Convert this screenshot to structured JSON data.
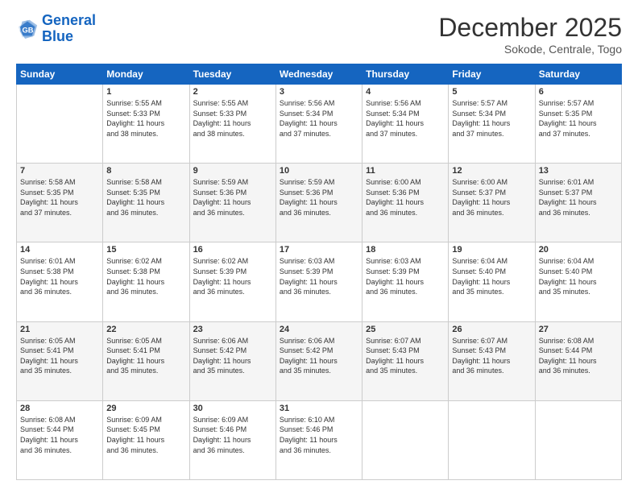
{
  "header": {
    "logo_line1": "General",
    "logo_line2": "Blue",
    "month": "December 2025",
    "location": "Sokode, Centrale, Togo"
  },
  "days_of_week": [
    "Sunday",
    "Monday",
    "Tuesday",
    "Wednesday",
    "Thursday",
    "Friday",
    "Saturday"
  ],
  "weeks": [
    [
      {
        "day": "",
        "info": ""
      },
      {
        "day": "1",
        "info": "Sunrise: 5:55 AM\nSunset: 5:33 PM\nDaylight: 11 hours\nand 38 minutes."
      },
      {
        "day": "2",
        "info": "Sunrise: 5:55 AM\nSunset: 5:33 PM\nDaylight: 11 hours\nand 38 minutes."
      },
      {
        "day": "3",
        "info": "Sunrise: 5:56 AM\nSunset: 5:34 PM\nDaylight: 11 hours\nand 37 minutes."
      },
      {
        "day": "4",
        "info": "Sunrise: 5:56 AM\nSunset: 5:34 PM\nDaylight: 11 hours\nand 37 minutes."
      },
      {
        "day": "5",
        "info": "Sunrise: 5:57 AM\nSunset: 5:34 PM\nDaylight: 11 hours\nand 37 minutes."
      },
      {
        "day": "6",
        "info": "Sunrise: 5:57 AM\nSunset: 5:35 PM\nDaylight: 11 hours\nand 37 minutes."
      }
    ],
    [
      {
        "day": "7",
        "info": "Sunrise: 5:58 AM\nSunset: 5:35 PM\nDaylight: 11 hours\nand 37 minutes."
      },
      {
        "day": "8",
        "info": "Sunrise: 5:58 AM\nSunset: 5:35 PM\nDaylight: 11 hours\nand 36 minutes."
      },
      {
        "day": "9",
        "info": "Sunrise: 5:59 AM\nSunset: 5:36 PM\nDaylight: 11 hours\nand 36 minutes."
      },
      {
        "day": "10",
        "info": "Sunrise: 5:59 AM\nSunset: 5:36 PM\nDaylight: 11 hours\nand 36 minutes."
      },
      {
        "day": "11",
        "info": "Sunrise: 6:00 AM\nSunset: 5:36 PM\nDaylight: 11 hours\nand 36 minutes."
      },
      {
        "day": "12",
        "info": "Sunrise: 6:00 AM\nSunset: 5:37 PM\nDaylight: 11 hours\nand 36 minutes."
      },
      {
        "day": "13",
        "info": "Sunrise: 6:01 AM\nSunset: 5:37 PM\nDaylight: 11 hours\nand 36 minutes."
      }
    ],
    [
      {
        "day": "14",
        "info": "Sunrise: 6:01 AM\nSunset: 5:38 PM\nDaylight: 11 hours\nand 36 minutes."
      },
      {
        "day": "15",
        "info": "Sunrise: 6:02 AM\nSunset: 5:38 PM\nDaylight: 11 hours\nand 36 minutes."
      },
      {
        "day": "16",
        "info": "Sunrise: 6:02 AM\nSunset: 5:39 PM\nDaylight: 11 hours\nand 36 minutes."
      },
      {
        "day": "17",
        "info": "Sunrise: 6:03 AM\nSunset: 5:39 PM\nDaylight: 11 hours\nand 36 minutes."
      },
      {
        "day": "18",
        "info": "Sunrise: 6:03 AM\nSunset: 5:39 PM\nDaylight: 11 hours\nand 36 minutes."
      },
      {
        "day": "19",
        "info": "Sunrise: 6:04 AM\nSunset: 5:40 PM\nDaylight: 11 hours\nand 35 minutes."
      },
      {
        "day": "20",
        "info": "Sunrise: 6:04 AM\nSunset: 5:40 PM\nDaylight: 11 hours\nand 35 minutes."
      }
    ],
    [
      {
        "day": "21",
        "info": "Sunrise: 6:05 AM\nSunset: 5:41 PM\nDaylight: 11 hours\nand 35 minutes."
      },
      {
        "day": "22",
        "info": "Sunrise: 6:05 AM\nSunset: 5:41 PM\nDaylight: 11 hours\nand 35 minutes."
      },
      {
        "day": "23",
        "info": "Sunrise: 6:06 AM\nSunset: 5:42 PM\nDaylight: 11 hours\nand 35 minutes."
      },
      {
        "day": "24",
        "info": "Sunrise: 6:06 AM\nSunset: 5:42 PM\nDaylight: 11 hours\nand 35 minutes."
      },
      {
        "day": "25",
        "info": "Sunrise: 6:07 AM\nSunset: 5:43 PM\nDaylight: 11 hours\nand 35 minutes."
      },
      {
        "day": "26",
        "info": "Sunrise: 6:07 AM\nSunset: 5:43 PM\nDaylight: 11 hours\nand 36 minutes."
      },
      {
        "day": "27",
        "info": "Sunrise: 6:08 AM\nSunset: 5:44 PM\nDaylight: 11 hours\nand 36 minutes."
      }
    ],
    [
      {
        "day": "28",
        "info": "Sunrise: 6:08 AM\nSunset: 5:44 PM\nDaylight: 11 hours\nand 36 minutes."
      },
      {
        "day": "29",
        "info": "Sunrise: 6:09 AM\nSunset: 5:45 PM\nDaylight: 11 hours\nand 36 minutes."
      },
      {
        "day": "30",
        "info": "Sunrise: 6:09 AM\nSunset: 5:46 PM\nDaylight: 11 hours\nand 36 minutes."
      },
      {
        "day": "31",
        "info": "Sunrise: 6:10 AM\nSunset: 5:46 PM\nDaylight: 11 hours\nand 36 minutes."
      },
      {
        "day": "",
        "info": ""
      },
      {
        "day": "",
        "info": ""
      },
      {
        "day": "",
        "info": ""
      }
    ]
  ]
}
